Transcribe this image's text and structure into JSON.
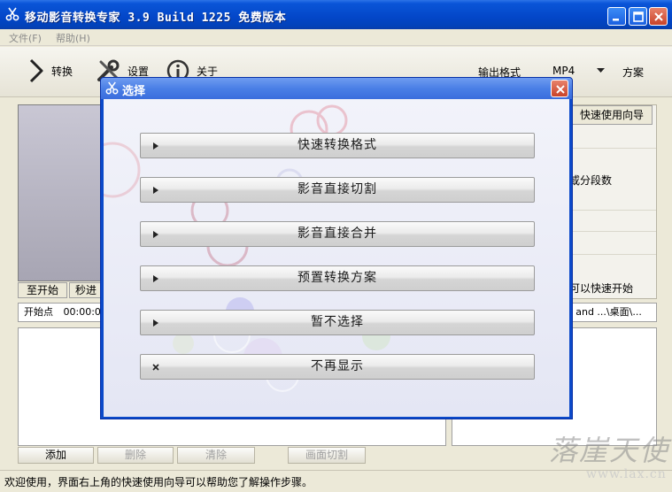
{
  "window": {
    "title": "移动影音转换专家 3.9 Build 1225 免费版本"
  },
  "menu": {
    "items": [
      "文件(F)",
      "帮助(H)"
    ]
  },
  "toolbar": {
    "convert_label": "转换",
    "settings_label": "设置",
    "about_label": "关于",
    "output_format_label": "输出格式",
    "output_format_value": "MP4",
    "scheme_label": "方案"
  },
  "left_panel": {
    "to_start_label": "至开始",
    "seconds_label": "秒进",
    "start_point_label": "开始点",
    "start_point_value": "00:00:0"
  },
  "right_panel": {
    "wizard_label": "快速使用向导",
    "segment_text": "或分段数",
    "quick_start_text": "可以快速开始",
    "path_text": "s and ...\\桌面\\..."
  },
  "bottom_buttons": {
    "add_label": "添加",
    "delete_label": "删除",
    "clear_label": "清除",
    "screen_cut_label": "画面切割"
  },
  "statusbar": {
    "text": "欢迎使用，界面右上角的快速使用向导可以帮助您了解操作步骤。"
  },
  "watermark": {
    "main": "落崖天使",
    "sub": "www.lax.cn"
  },
  "dialog": {
    "title": "选择",
    "options": [
      {
        "label": "快速转换格式",
        "icon": "triangle-right-icon"
      },
      {
        "label": "影音直接切割",
        "icon": "triangle-right-icon"
      },
      {
        "label": "影音直接合并",
        "icon": "triangle-right-icon"
      },
      {
        "label": "预置转换方案",
        "icon": "triangle-right-icon"
      },
      {
        "label": "暂不选择",
        "icon": "triangle-right-icon"
      },
      {
        "label": "不再显示",
        "icon": "x-mark-icon"
      }
    ]
  },
  "colors": {
    "titlebar_blue": "#0346c8",
    "dialog_border": "#0b49c9",
    "close_red": "#c9432a"
  }
}
